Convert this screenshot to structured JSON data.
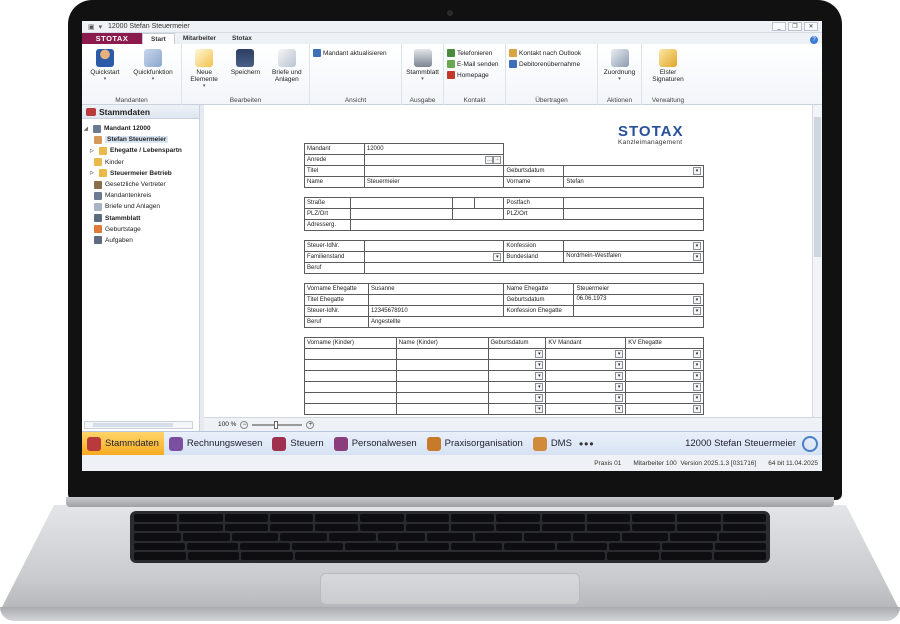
{
  "window": {
    "title": "12000 Stefan Steuermeier"
  },
  "ribbon_tabs": [
    "Start",
    "Mitarbeiter",
    "Stotax"
  ],
  "logo_text": "STOTAX",
  "ribbon": {
    "mandanten": {
      "label": "Mandanten",
      "quickstart": "Quickstart",
      "quickfunktion": "Quickfunktion"
    },
    "bearbeiten": {
      "label": "Bearbeiten",
      "neue_elemente": "Neue Elemente",
      "speichern": "Speichern",
      "briefe": "Briefe und Anlagen"
    },
    "ansicht": {
      "label": "Ansicht",
      "mandant_aktualisieren": "Mandant aktualisieren"
    },
    "ausgabe": {
      "label": "Ausgabe",
      "stammblatt": "Stammblatt"
    },
    "kontakt": {
      "label": "Kontakt",
      "telefonieren": "Telefonieren",
      "email": "E-Mail senden",
      "homepage": "Homepage"
    },
    "uebertragen": {
      "label": "Übertragen",
      "outlook": "Kontakt nach Outlook",
      "debitoren": "Debitorenübernahme"
    },
    "aktionen": {
      "label": "Aktionen",
      "zuordnung": "Zuordnung"
    },
    "verwaltung": {
      "label": "Verwaltung",
      "elster": "Elster Signaturen"
    }
  },
  "nav": {
    "header": "Stammdaten",
    "items": [
      {
        "label": "Mandant 12000"
      },
      {
        "label": "Stefan Steuermeier"
      },
      {
        "label": "Ehegatte / Lebenspartn"
      },
      {
        "label": "Kinder"
      },
      {
        "label": "Steuermeier Betrieb"
      },
      {
        "label": "Gesetzliche Vertreter"
      },
      {
        "label": "Mandantenkreis"
      },
      {
        "label": "Briefe und Anlagen"
      },
      {
        "label": "Stammblatt"
      },
      {
        "label": "Geburtstage"
      },
      {
        "label": "Aufgaben"
      }
    ]
  },
  "form": {
    "logo_big": "STOTAX",
    "logo_small": "Kanzleimanagement",
    "mandant_label": "Mandant",
    "mandant_value": "12000",
    "anrede_label": "Anrede",
    "titel_label": "Titel",
    "geburtsdatum_label": "Geburtsdatum",
    "name_label": "Name",
    "name_value": "Steuermeier",
    "vorname_label": "Vorname",
    "vorname_value": "Stefan",
    "strasse_label": "Straße",
    "postfach_label": "Postfach",
    "plzort_label": "PLZ/Ort",
    "plzort2_label": "PLZ/Ort",
    "adresserg_label": "Adresserg.",
    "steuer_label": "Steuer-IdNr.",
    "konfession_label": "Konfession",
    "familienstand_label": "Familienstand",
    "bundesland_label": "Bundesland",
    "bundesland_value": "Nordrhein-Westfalen",
    "beruf_label": "Beruf",
    "vorname_ehegatte_label": "Vorname Ehegatte",
    "vorname_ehegatte_value": "Susanne",
    "name_ehegatte_label": "Name Ehegatte",
    "name_ehegatte_value": "Steuermeier",
    "titel_ehegatte_label": "Titel Ehegatte",
    "geb_ehegatte_label": "Geburtsdatum",
    "geb_ehegatte_value": "06.06.1973",
    "steuer_ehegatte_label": "Steuer-IdNr.",
    "steuer_ehegatte_value": "12345678910",
    "konf_ehegatte_label": "Konfession Ehegatte",
    "beruf_ehegatte_label": "Beruf",
    "beruf_ehegatte_value": "Angestellte",
    "kinder_headers": [
      "Vorname (Kinder)",
      "Name (Kinder)",
      "Geburtsdatum",
      "KV Mandant",
      "KV Ehegatte"
    ]
  },
  "zoom": "100 %",
  "modules": [
    "Stammdaten",
    "Rechnungswesen",
    "Steuern",
    "Personalwesen",
    "Praxisorganisation",
    "DMS"
  ],
  "modules_more": "•••",
  "current_client": "12000 Stefan Steuermeier",
  "status": {
    "praxis": "Praxis 01",
    "mitarbeiter": "Mitarbeiter 100",
    "version": "Version 2025.1.3",
    "build": "[031716]",
    "bit_date": "64 bit 11.04.2025"
  }
}
